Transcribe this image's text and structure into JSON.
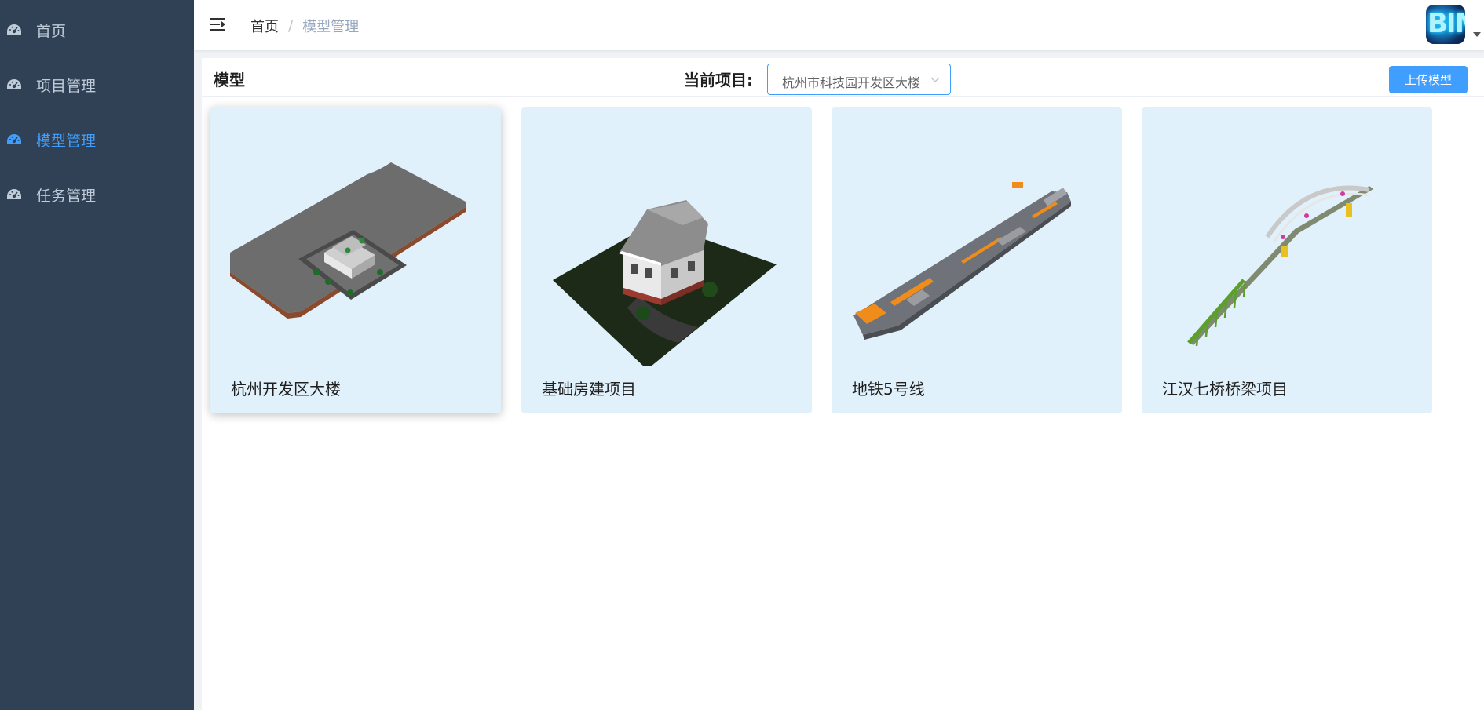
{
  "sidebar": {
    "items": [
      {
        "label": "首页",
        "icon": "dashboard-icon",
        "active": false
      },
      {
        "label": "项目管理",
        "icon": "dashboard-icon",
        "active": false
      },
      {
        "label": "模型管理",
        "icon": "dashboard-icon",
        "active": true
      },
      {
        "label": "任务管理",
        "icon": "dashboard-icon",
        "active": false
      }
    ]
  },
  "header": {
    "breadcrumb": {
      "home": "首页",
      "separator": "/",
      "current": "模型管理"
    },
    "avatar_text": "BIM"
  },
  "panel": {
    "title": "模型",
    "project_label": "当前项目:",
    "project_select_value": "杭州市科技园开发区大楼",
    "upload_label": "上传模型"
  },
  "models": [
    {
      "name": "杭州开发区大楼",
      "thumbnail": "building-model-thumbnail"
    },
    {
      "name": "基础房建项目",
      "thumbnail": "house-model-thumbnail"
    },
    {
      "name": "地铁5号线",
      "thumbnail": "subway-model-thumbnail"
    },
    {
      "name": "江汉七桥桥梁项目",
      "thumbnail": "bridge-model-thumbnail"
    }
  ],
  "colors": {
    "sidebar_bg": "#304156",
    "sidebar_text": "#bfcbd9",
    "accent": "#409eff",
    "card_bg": "#e1f1fb"
  }
}
